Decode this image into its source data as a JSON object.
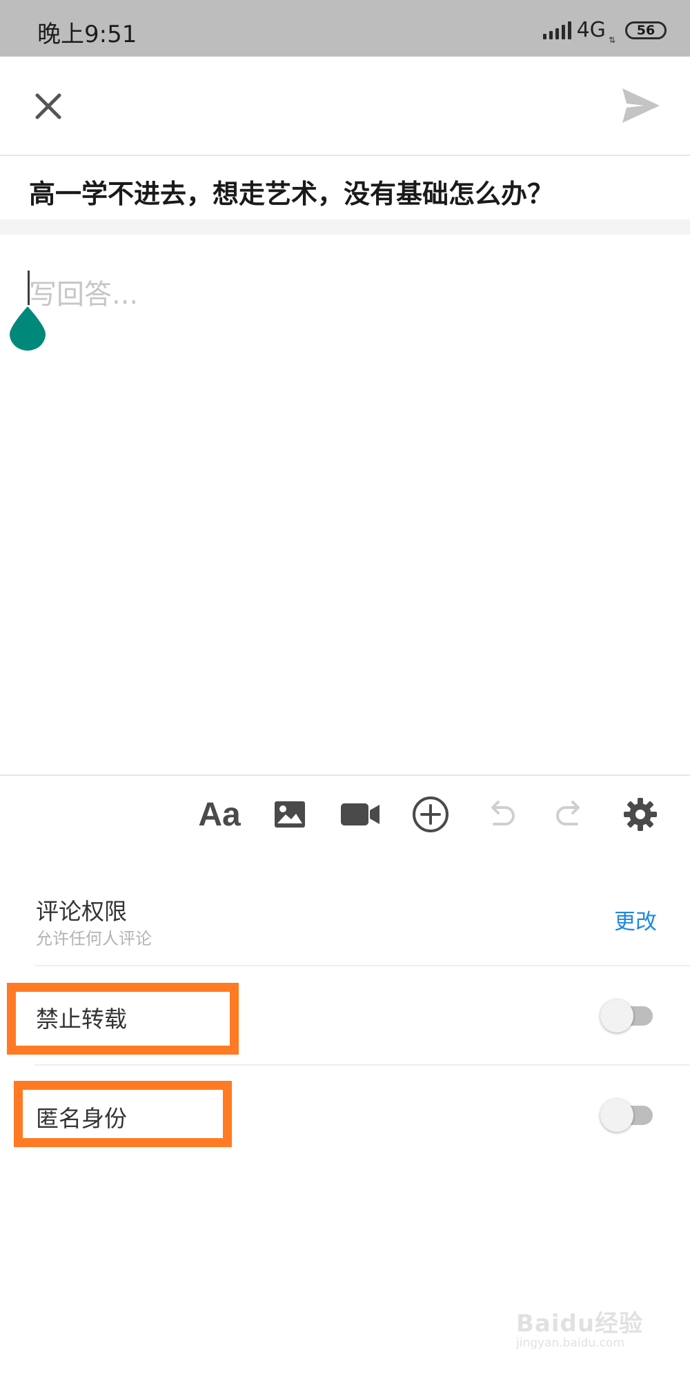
{
  "status_bar": {
    "time": "晚上9:51",
    "network": "4G",
    "battery": "56"
  },
  "top_bar": {
    "close_icon": "close-icon",
    "send_icon": "send-icon"
  },
  "question": {
    "title": "高一学不进去，想走艺术，没有基础怎么办？"
  },
  "editor": {
    "placeholder": "写回答..."
  },
  "toolbar": {
    "font_label": "Aa",
    "items": [
      "font-format-icon",
      "image-icon",
      "video-icon",
      "add-icon",
      "undo-icon",
      "redo-icon",
      "settings-icon"
    ]
  },
  "settings": {
    "comment_permission": {
      "title": "评论权限",
      "subtitle": "允许任何人评论",
      "action": "更改"
    },
    "no_repost": {
      "title": "禁止转载",
      "enabled": false
    },
    "anonymous": {
      "title": "匿名身份",
      "enabled": false
    }
  },
  "colors": {
    "accent_link": "#1e88e5",
    "highlight": "#ff7a22",
    "cursor_handle": "#00897b"
  },
  "watermark": {
    "text": "Baidu经验",
    "url": "jingyan.baidu.com"
  }
}
